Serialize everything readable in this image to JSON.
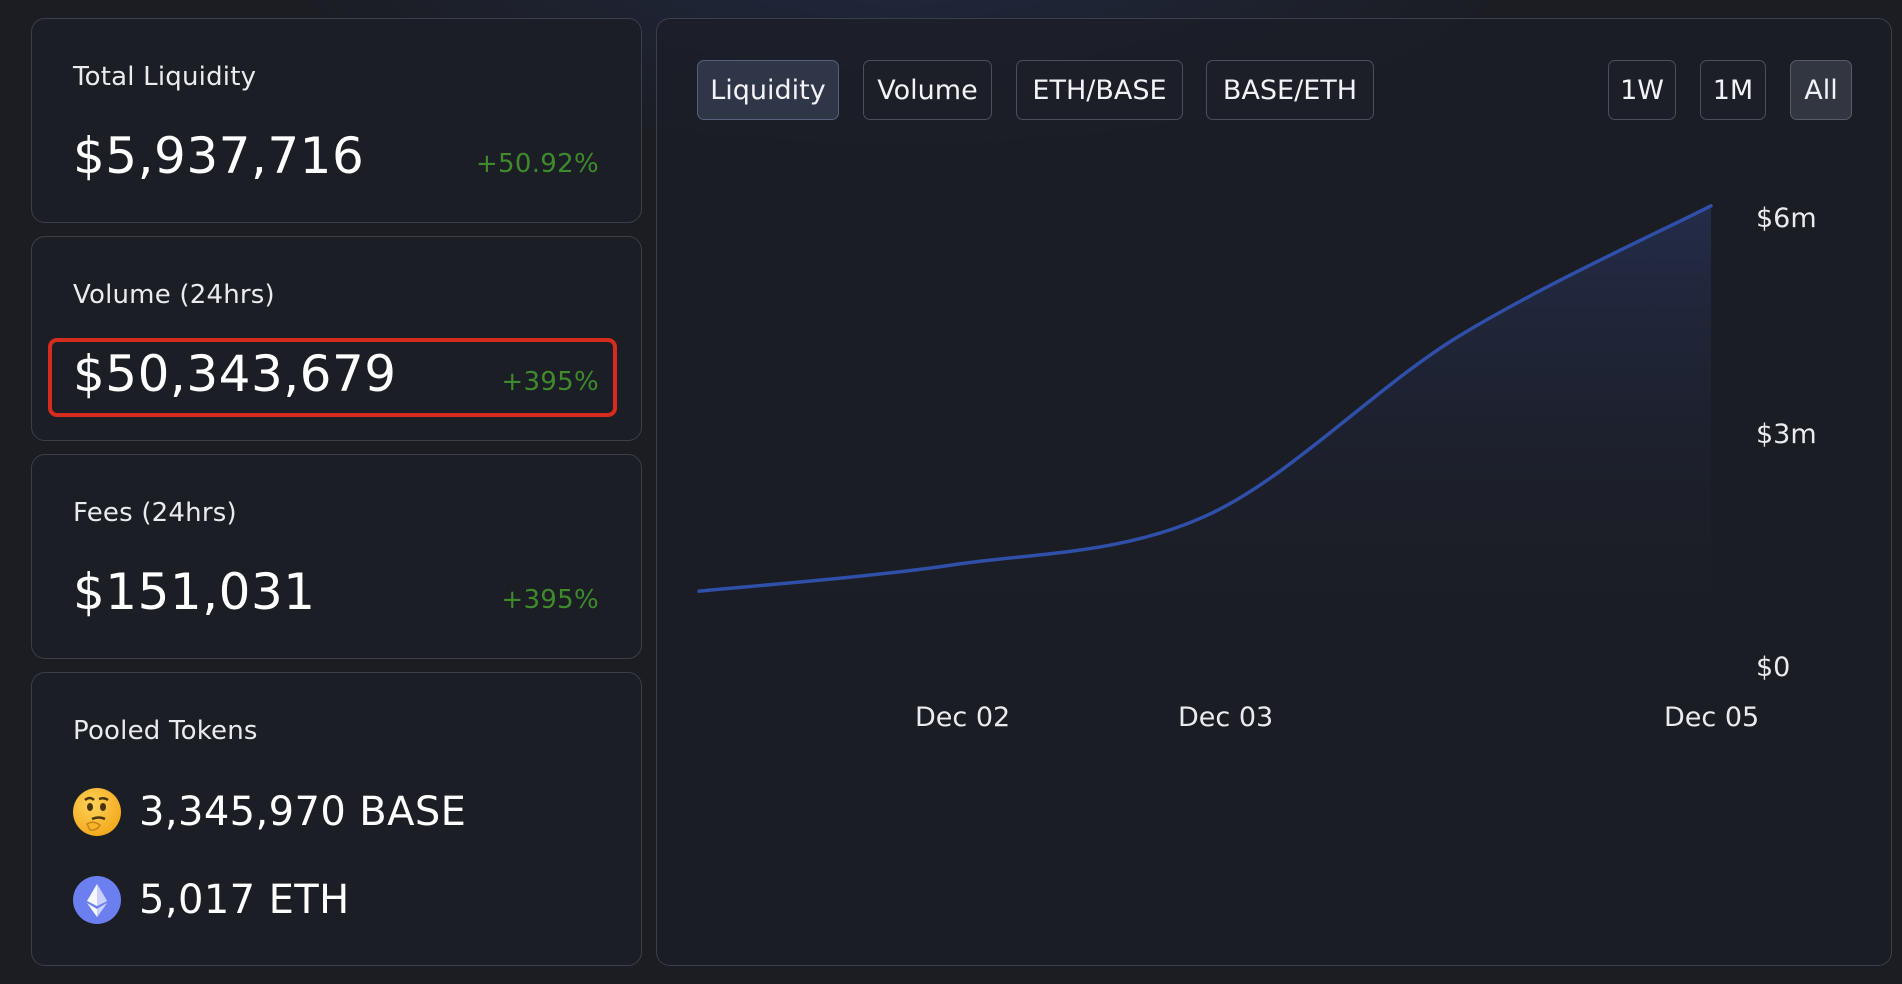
{
  "cards": {
    "total_liquidity": {
      "title": "Total Liquidity",
      "value": "$5,937,716",
      "change": "+50.92%"
    },
    "volume": {
      "title": "Volume (24hrs)",
      "value": "$50,343,679",
      "change": "+395%"
    },
    "fees": {
      "title": "Fees (24hrs)",
      "value": "$151,031",
      "change": "+395%"
    },
    "pooled_tokens": {
      "title": "Pooled Tokens",
      "tokens": [
        {
          "amount": "3,345,970 BASE",
          "icon": "thinking-face-icon"
        },
        {
          "amount": "5,017 ETH",
          "icon": "ethereum-icon"
        }
      ]
    }
  },
  "chart_tabs": {
    "liquidity": "Liquidity",
    "volume": "Volume",
    "eth_base": "ETH/BASE",
    "base_eth": "BASE/ETH"
  },
  "range_tabs": {
    "one_week": "1W",
    "one_month": "1M",
    "all": "All"
  },
  "colors": {
    "positive_change": "#3e8a2c",
    "line": "#2f4fa8",
    "highlight": "#d62b1f"
  },
  "chart_data": {
    "type": "area",
    "y_tick_labels": [
      "$6m",
      "$3m",
      "$0"
    ],
    "x_tick_labels": [
      "Dec 02",
      "Dec 03",
      "Dec 05"
    ],
    "ylim": [
      0,
      6000000
    ],
    "series": [
      {
        "x": [
          "Dec 01",
          "Dec 02",
          "Dec 03",
          "Dec 04",
          "Dec 05"
        ],
        "values": [
          1000000,
          1350000,
          2000000,
          4400000,
          6150000
        ]
      }
    ]
  }
}
